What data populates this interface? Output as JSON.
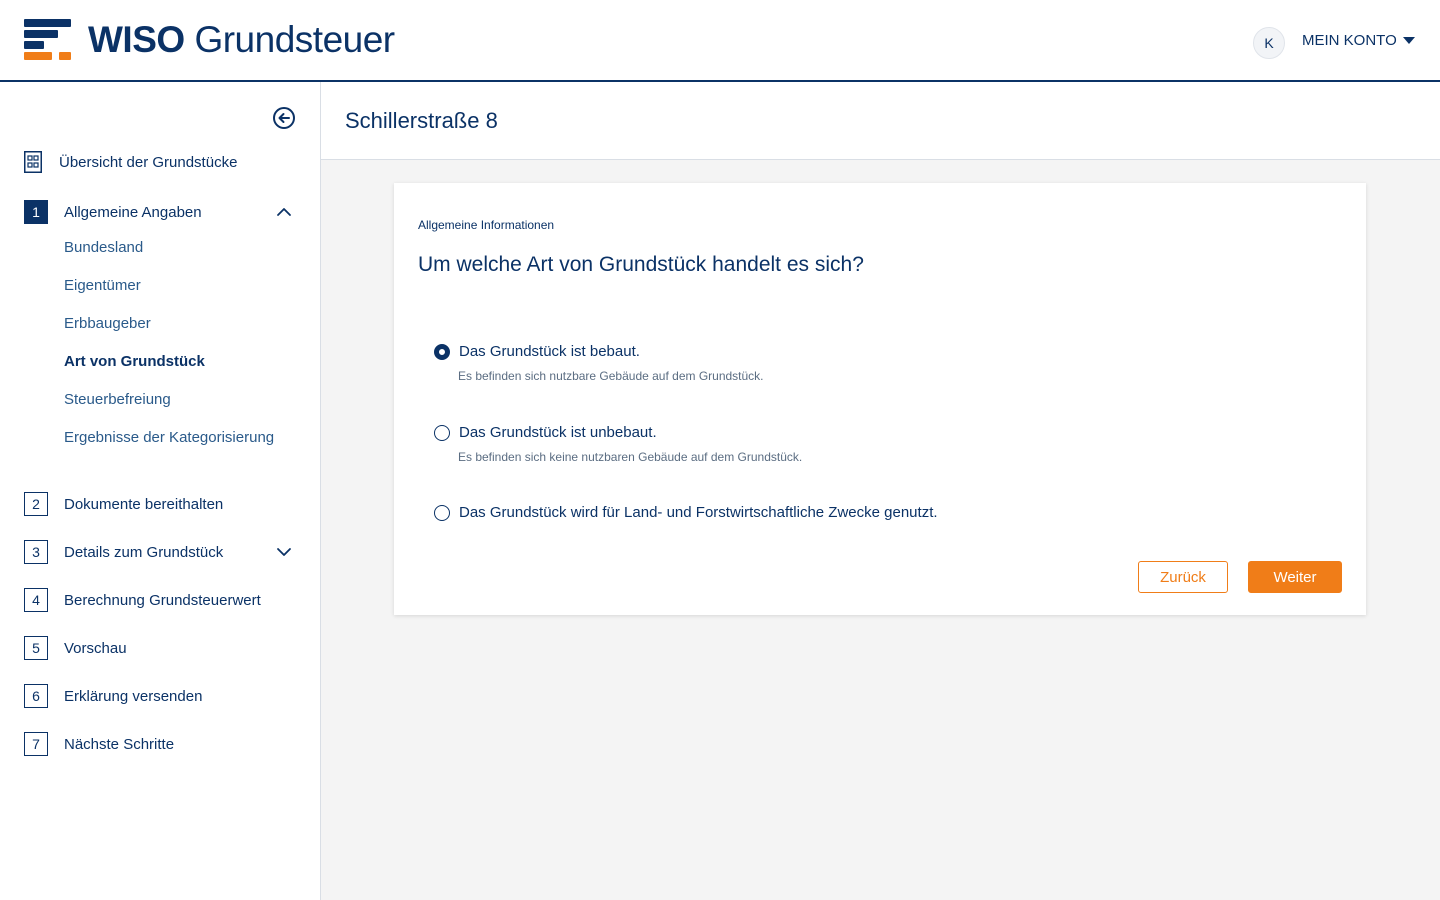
{
  "header": {
    "brand_bold": "WISO",
    "brand_rest": "Grundsteuer",
    "avatar_initial": "K",
    "account_label": "MEIN KONTO",
    "colors": {
      "navy": "#0b3266",
      "orange": "#f07d18"
    }
  },
  "sidebar": {
    "overview_label": "Übersicht der Grundstücke",
    "steps": [
      {
        "num": "1",
        "label": "Allgemeine Angaben",
        "expanded": true
      },
      {
        "num": "2",
        "label": "Dokumente bereithalten"
      },
      {
        "num": "3",
        "label": "Details zum Grundstück",
        "expanded": false
      },
      {
        "num": "4",
        "label": "Berechnung Grundsteuerwert"
      },
      {
        "num": "5",
        "label": "Vorschau"
      },
      {
        "num": "6",
        "label": "Erklärung versenden"
      },
      {
        "num": "7",
        "label": "Nächste Schritte"
      }
    ],
    "substeps": [
      {
        "label": "Bundesland"
      },
      {
        "label": "Eigentümer"
      },
      {
        "label": "Erbbaugeber"
      },
      {
        "label": "Art von Grundstück",
        "current": true
      },
      {
        "label": "Steuerbefreiung"
      },
      {
        "label": "Ergebnisse der Kategorisierung"
      }
    ]
  },
  "main": {
    "title": "Schillerstraße 8",
    "card": {
      "section_label": "Allgemeine Informationen",
      "question": "Um welche Art von Grundstück handelt es sich?",
      "options": [
        {
          "label": "Das Grundstück ist bebaut.",
          "description": "Es befinden sich nutzbare Gebäude auf dem Grundstück.",
          "selected": true
        },
        {
          "label": "Das Grundstück ist unbebaut.",
          "description": "Es befinden sich keine nutzbaren Gebäude auf dem Grundstück.",
          "selected": false
        },
        {
          "label": "Das Grundstück wird für Land- und Forstwirtschaftliche Zwecke genutzt.",
          "selected": false
        }
      ],
      "back_label": "Zurück",
      "next_label": "Weiter"
    }
  }
}
